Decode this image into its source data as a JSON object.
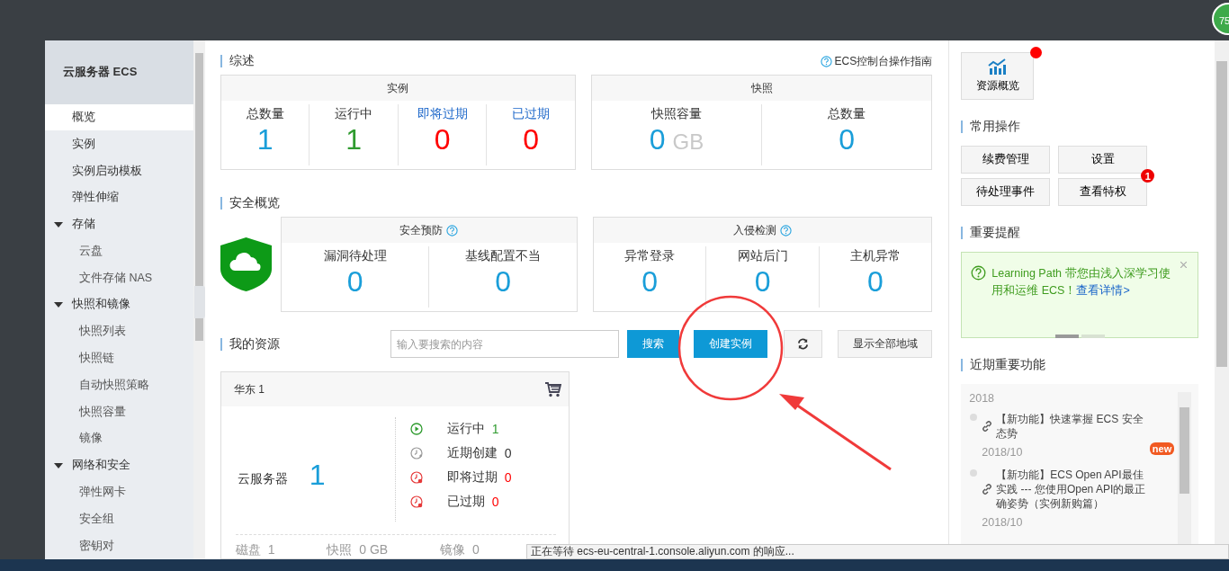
{
  "corner_badge": "75",
  "sidebar": {
    "title": "云服务器 ECS",
    "items": [
      {
        "label": "概览",
        "selected": true
      },
      {
        "label": "实例",
        "selected": false
      },
      {
        "label": "实例启动模板",
        "selected": false
      },
      {
        "label": "弹性伸缩",
        "selected": false
      },
      {
        "label": "存储",
        "selected": false,
        "expanded": true,
        "children": [
          {
            "label": "云盘",
            "selected": false
          },
          {
            "label": "文件存储 NAS",
            "selected": false
          }
        ]
      },
      {
        "label": "快照和镜像",
        "selected": false,
        "expanded": true,
        "children": [
          {
            "label": "快照列表",
            "selected": false
          },
          {
            "label": "快照链",
            "selected": false
          },
          {
            "label": "自动快照策略",
            "selected": false
          },
          {
            "label": "快照容量",
            "selected": false
          },
          {
            "label": "镜像",
            "selected": false
          }
        ]
      },
      {
        "label": "网络和安全",
        "selected": false,
        "expanded": true,
        "children": [
          {
            "label": "弹性网卡",
            "selected": false
          },
          {
            "label": "安全组",
            "selected": false
          },
          {
            "label": "密钥对",
            "selected": false
          }
        ]
      }
    ]
  },
  "overview": {
    "title": "综述",
    "guide_link": "ECS控制台操作指南",
    "instances": {
      "title": "实例",
      "stats": [
        {
          "label": "总数量",
          "link": false,
          "value": "1",
          "color": "#1a9ed9"
        },
        {
          "label": "运行中",
          "link": false,
          "value": "1",
          "color": "#2f9b2f"
        },
        {
          "label": "即将过期",
          "link": true,
          "value": "0",
          "color": "#ff0000"
        },
        {
          "label": "已过期",
          "link": true,
          "value": "0",
          "color": "#ff0000"
        }
      ]
    },
    "snapshots": {
      "title": "快照",
      "stats": [
        {
          "label": "快照容量",
          "value": "0",
          "unit": "GB"
        },
        {
          "label": "总数量",
          "value": "0"
        }
      ]
    }
  },
  "security": {
    "title": "安全概览",
    "prevention": {
      "title": "安全预防",
      "stats": [
        {
          "label": "漏洞待处理",
          "value": "0"
        },
        {
          "label": "基线配置不当",
          "value": "0"
        }
      ]
    },
    "intrusion": {
      "title": "入侵检测",
      "stats": [
        {
          "label": "异常登录",
          "value": "0"
        },
        {
          "label": "网站后门",
          "value": "0"
        },
        {
          "label": "主机异常",
          "value": "0"
        }
      ]
    }
  },
  "resources": {
    "title": "我的资源",
    "search": {
      "placeholder": "输入要搜索的内容"
    },
    "search_button": "搜索",
    "create_button": "创建实例",
    "region_button": "显示全部地域",
    "region": {
      "title": "华东 1",
      "server_label": "云服务器",
      "server_count": "1",
      "statuses": [
        {
          "kind": "running",
          "label": "运行中",
          "value": "1",
          "color": "#2f9b2f"
        },
        {
          "kind": "recent",
          "label": "近期创建",
          "value": "0",
          "color": "#333333"
        },
        {
          "kind": "expiring",
          "label": "即将过期",
          "value": "0",
          "color": "#ff0000"
        },
        {
          "kind": "expired",
          "label": "已过期",
          "value": "0",
          "color": "#ff0000"
        }
      ],
      "footer": [
        {
          "label": "磁盘",
          "value": "1"
        },
        {
          "label": "快照",
          "value": "0 GB"
        },
        {
          "label": "镜像",
          "value": "0"
        }
      ]
    }
  },
  "right_panel": {
    "overview_button": {
      "label": "资源概览",
      "notify": true
    },
    "common_ops": {
      "title": "常用操作",
      "buttons": [
        {
          "label": "续费管理"
        },
        {
          "label": "设置"
        },
        {
          "label": "待处理事件"
        },
        {
          "label": "查看特权",
          "badge": "1"
        }
      ]
    },
    "reminders": {
      "title": "重要提醒",
      "notice": "Learning Path 带您由浅入深学习使用和运维 ECS！",
      "link": "查看详情>",
      "pages": [
        {
          "selected": true
        },
        {
          "selected": false
        }
      ]
    },
    "features": {
      "title": "近期重要功能",
      "year": "2018",
      "items": [
        {
          "title": "【新功能】快速掌握 ECS 安全态势",
          "badge": "new",
          "date": "2018/10"
        },
        {
          "title": "【新功能】ECS Open API最佳实践 --- 您使用Open API的最正确姿势（实例新购篇）",
          "date": "2018/10"
        }
      ]
    }
  },
  "status_bar": "正在等待 ecs-eu-central-1.console.aliyun.com 的响应..."
}
